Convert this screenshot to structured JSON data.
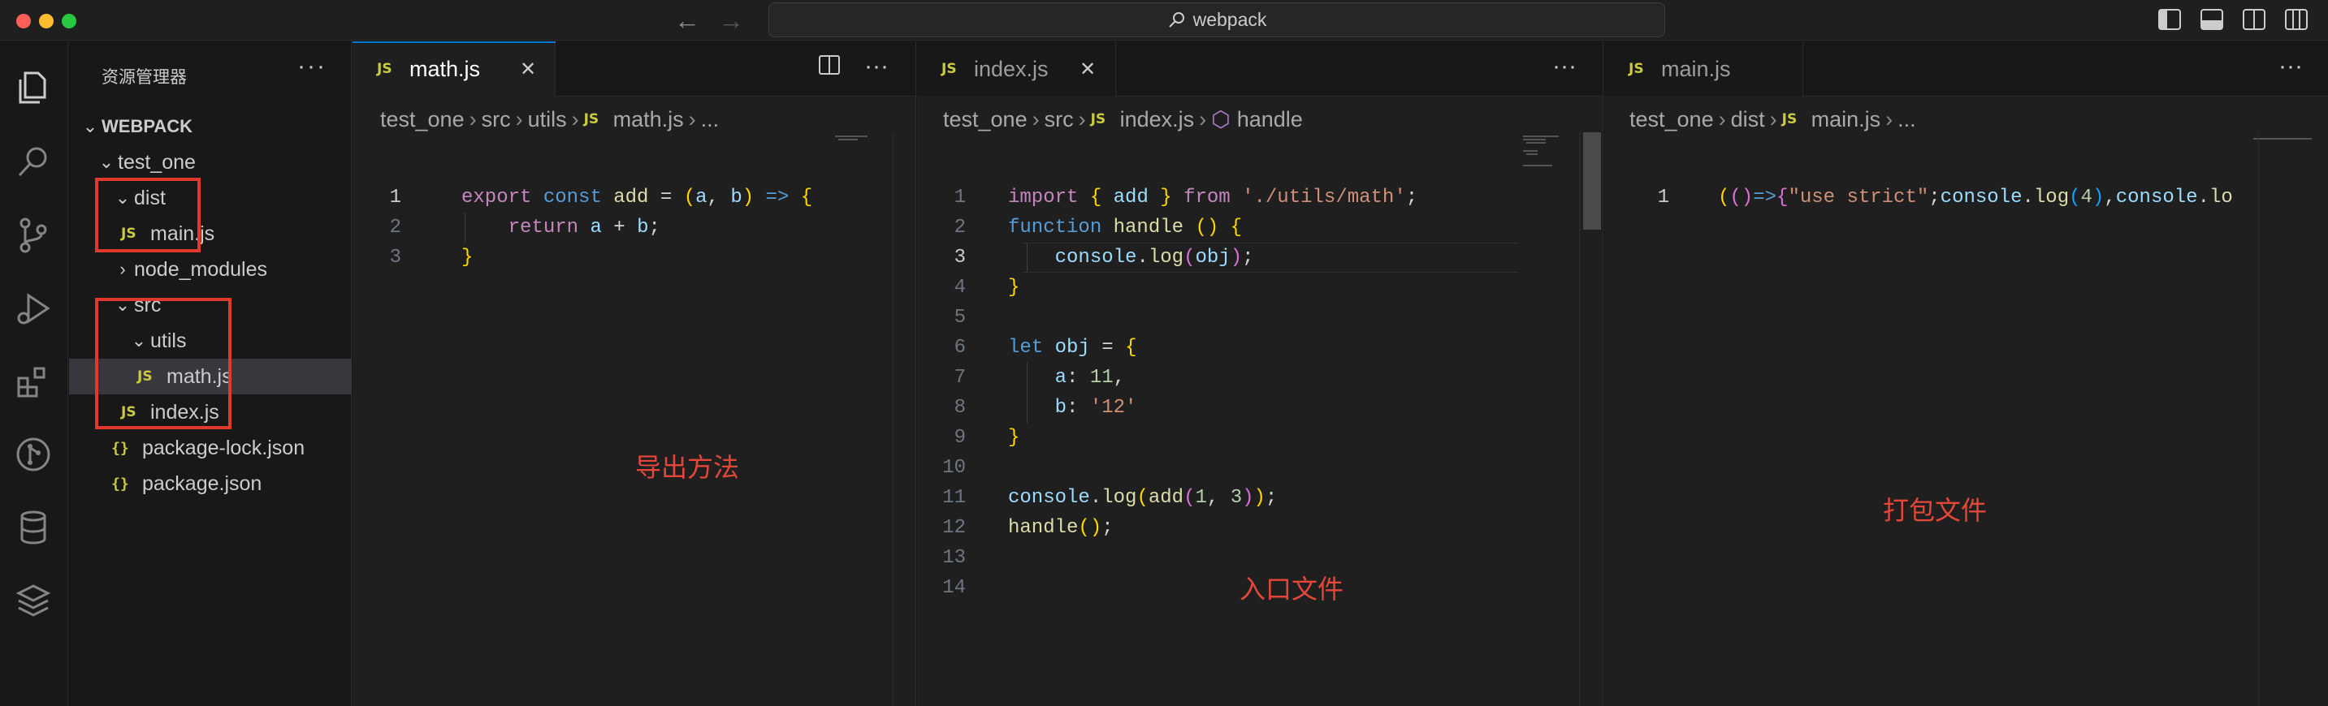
{
  "window": {
    "search_text": "webpack"
  },
  "sidebar": {
    "title": "资源管理器",
    "more": "···",
    "root": "WEBPACK",
    "items": [
      {
        "label": "test_one"
      },
      {
        "label": "dist"
      },
      {
        "label": "main.js",
        "icon": "JS"
      },
      {
        "label": "node_modules"
      },
      {
        "label": "src"
      },
      {
        "label": "utils"
      },
      {
        "label": "math.js",
        "icon": "JS"
      },
      {
        "label": "index.js",
        "icon": "JS"
      },
      {
        "label": "package-lock.json",
        "icon": "{}"
      },
      {
        "label": "package.json",
        "icon": "{}"
      }
    ]
  },
  "editors": {
    "math": {
      "tab": "math.js",
      "icon": "JS",
      "breadcrumb": [
        "test_one",
        "src",
        "utils",
        "math.js",
        "..."
      ],
      "lines": [
        "export const add = (a, b) => {",
        "    return a + b;",
        "}"
      ],
      "annotation": "导出方法"
    },
    "index": {
      "tab": "index.js",
      "icon": "JS",
      "breadcrumb": [
        "test_one",
        "src",
        "index.js",
        "handle"
      ],
      "lines": [
        "import { add } from './utils/math';",
        "function handle () {",
        "    console.log(obj);",
        "}",
        "",
        "let obj = {",
        "    a: 11,",
        "    b: '12'",
        "}",
        "",
        "console.log(add(1, 3));",
        "handle();",
        "",
        ""
      ],
      "annotation": "入口文件"
    },
    "main": {
      "tab": "main.js",
      "icon": "JS",
      "breadcrumb": [
        "test_one",
        "dist",
        "main.js",
        "..."
      ],
      "lines": [
        "(()=>{\"use strict\";console.log(4),console.lo"
      ],
      "annotation": "打包文件"
    }
  },
  "colors": {
    "annotation": "#e4473a",
    "accent": "#0078d4",
    "js_icon": "#cbcb41"
  },
  "icons": [
    "files-icon",
    "search-icon",
    "source-control-icon",
    "run-debug-icon",
    "extensions-icon",
    "git-graph-icon",
    "database-icon",
    "layers-icon"
  ]
}
